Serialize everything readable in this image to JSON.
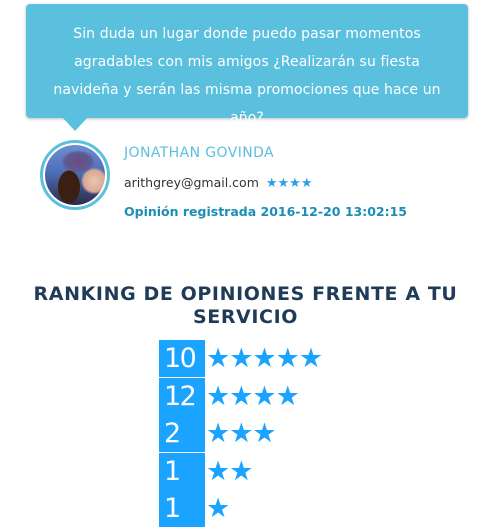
{
  "testimonial": {
    "text": "Sin duda un lugar donde puedo pasar momentos agradables con mis amigos ¿Realizarán su fiesta navideña y serán las misma promociones que hace un año?",
    "author_name": "JONATHAN GOVINDA",
    "author_email": "arithgrey@gmail.com",
    "author_stars": "★★★★",
    "author_rating": 4,
    "date_line": "Opinión registrada 2016-12-20 13:02:15",
    "avatar_icon": "user-photo"
  },
  "ranking": {
    "title": "RANKING DE OPINIONES FRENTE A TU SERVICIO",
    "rows": [
      {
        "count": "10",
        "stars": "★★★★★",
        "rating": 5
      },
      {
        "count": "12",
        "stars": "★★★★",
        "rating": 4
      },
      {
        "count": "2",
        "stars": "★★★",
        "rating": 3
      },
      {
        "count": "1",
        "stars": "★★",
        "rating": 2
      },
      {
        "count": "1",
        "stars": "★",
        "rating": 1
      }
    ]
  },
  "colors": {
    "bubble": "#5bc0de",
    "accent": "#1aa3ff",
    "title": "#1f3b57",
    "date": "#1a8fb3"
  }
}
